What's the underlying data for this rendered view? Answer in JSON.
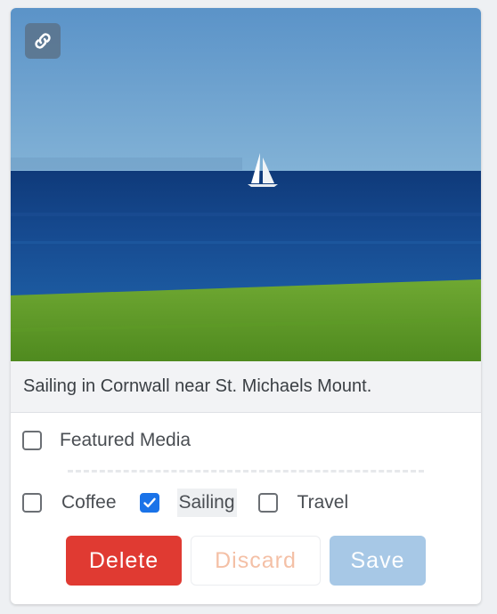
{
  "media": {
    "image_alt": "Sailboat on the sea off a green coastal meadow",
    "caption": "Sailing in Cornwall near St. Michaels Mount."
  },
  "featured": {
    "label": "Featured Media",
    "checked": false
  },
  "tags": [
    {
      "label": "Coffee",
      "checked": false
    },
    {
      "label": "Sailing",
      "checked": true
    },
    {
      "label": "Travel",
      "checked": false
    }
  ],
  "buttons": {
    "delete": "Delete",
    "discard": "Discard",
    "save": "Save"
  },
  "colors": {
    "delete": "#e03a32",
    "checkbox_checked": "#1a73e8",
    "save_disabled": "#a7c8e6",
    "discard_text": "#f4c0a6"
  },
  "icons": {
    "link": "link-icon",
    "check": "check-icon"
  }
}
